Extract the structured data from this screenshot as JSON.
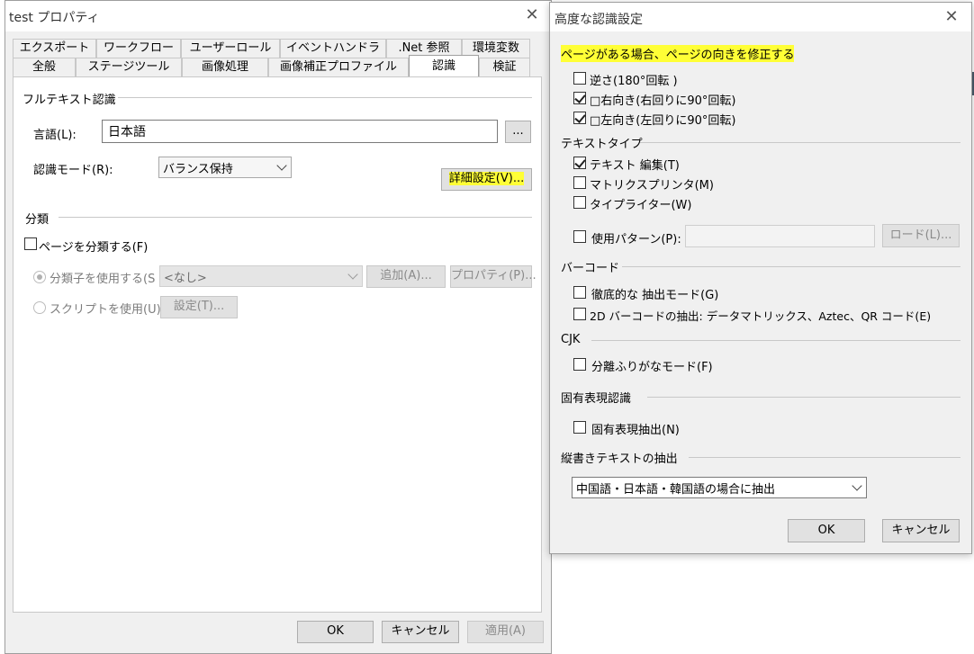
{
  "window1": {
    "title": "test プロパティ",
    "tabs_row1": [
      "エクスポート",
      "ワークフロー",
      "ユーザーロール",
      "イベントハンドラ",
      ".Net 参照",
      "環境変数"
    ],
    "tabs_row2": [
      "全般",
      "ステージツール",
      "画像処理",
      "画像補正プロファイル",
      "認識",
      "検証"
    ],
    "selected_tab": "認識",
    "fulltext": {
      "group_label": "フルテキスト認識",
      "language_label": "言語(L):",
      "language_value": "日本語",
      "browse_button": "...",
      "mode_label": "認識モード(R):",
      "mode_value": "バランス保持",
      "advanced_button": "詳細設定(V)..."
    },
    "classification": {
      "group_label": "分類",
      "classify_checkbox": "ページを分類する(F)",
      "use_classifier_label": "分類子を使用する(S",
      "classifier_value": "<なし>",
      "add_button": "追加(A)...",
      "properties_button": "プロパティ(P)...",
      "use_script_label": "スクリプトを使用(U)",
      "settings_button": "設定(T)..."
    },
    "footer": {
      "ok": "OK",
      "cancel": "キャンセル",
      "apply": "適用(A)"
    }
  },
  "window2": {
    "title": "高度な認識設定",
    "orientation_heading": "ページがある場合、ページの向きを修正する",
    "rotate_180": "逆さ(180°回転 )",
    "rotate_right": "□右向き(右回りに90°回転)",
    "rotate_left": "□左向き(左回りに90°回転)",
    "text_type_group": "テキストタイプ",
    "text_edit": "テキスト 編集(T)",
    "dot_matrix": "マトリクスプリンタ(M)",
    "typewriter": "タイプライター(W)",
    "use_pattern": "使用パターン(P):",
    "load_button": "ロード(L)...",
    "barcode_group": "バーコード",
    "thorough_extract": "徹底的な 抽出モード(G)",
    "barcode_2d": "2D バーコードの抽出: データマトリックス、Aztec、QR コード(E)",
    "cjk_group": "CJK",
    "separate_furigana": "分離ふりがなモード(F)",
    "named_entity_group": "固有表現認識",
    "named_entity_extract": "固有表現抽出(N)",
    "vertical_text_group": "縦書きテキストの抽出",
    "vertical_text_value": "中国語・日本語・韓国語の場合に抽出",
    "ok": "OK",
    "cancel": "キャンセル"
  }
}
